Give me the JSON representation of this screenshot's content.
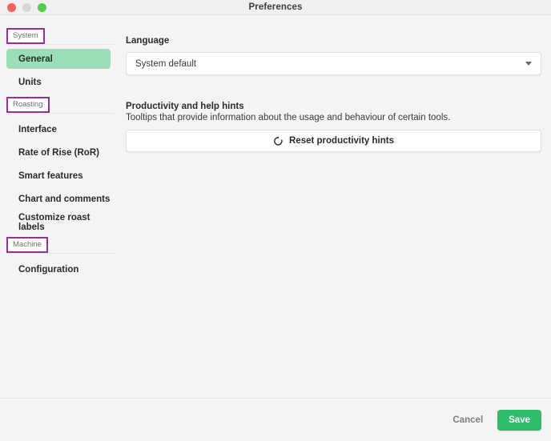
{
  "window": {
    "title": "Preferences",
    "traffic_lights": [
      {
        "name": "close",
        "color": "#f2625c"
      },
      {
        "name": "minimize",
        "color": "#d6d6d6"
      },
      {
        "name": "zoom",
        "color": "#55cc4b"
      }
    ]
  },
  "sidebar": {
    "sections": [
      {
        "header": "System",
        "items": [
          {
            "label": "General",
            "selected": true
          },
          {
            "label": "Units",
            "selected": false
          }
        ]
      },
      {
        "header": "Roasting",
        "items": [
          {
            "label": "Interface",
            "selected": false
          },
          {
            "label": "Rate of Rise (RoR)",
            "selected": false
          },
          {
            "label": "Smart features",
            "selected": false
          },
          {
            "label": "Chart and comments",
            "selected": false
          },
          {
            "label": "Customize roast labels",
            "selected": false
          }
        ]
      },
      {
        "header": "Machine",
        "items": [
          {
            "label": "Configuration",
            "selected": false
          }
        ]
      }
    ],
    "selected_color": "#9adfb8",
    "header_outline_color": "#9b2ca0"
  },
  "content": {
    "language": {
      "label": "Language",
      "selected_option": "System default",
      "caret_icon": "chevron-down-icon"
    },
    "hints": {
      "title": "Productivity and help hints",
      "description": "Tooltips that provide information about the usage and behaviour of certain tools.",
      "reset_button_label": "Reset productivity hints",
      "reset_button_icon": "refresh-icon"
    }
  },
  "footer": {
    "cancel_label": "Cancel",
    "save_label": "Save",
    "save_color": "#2ebd6b"
  }
}
